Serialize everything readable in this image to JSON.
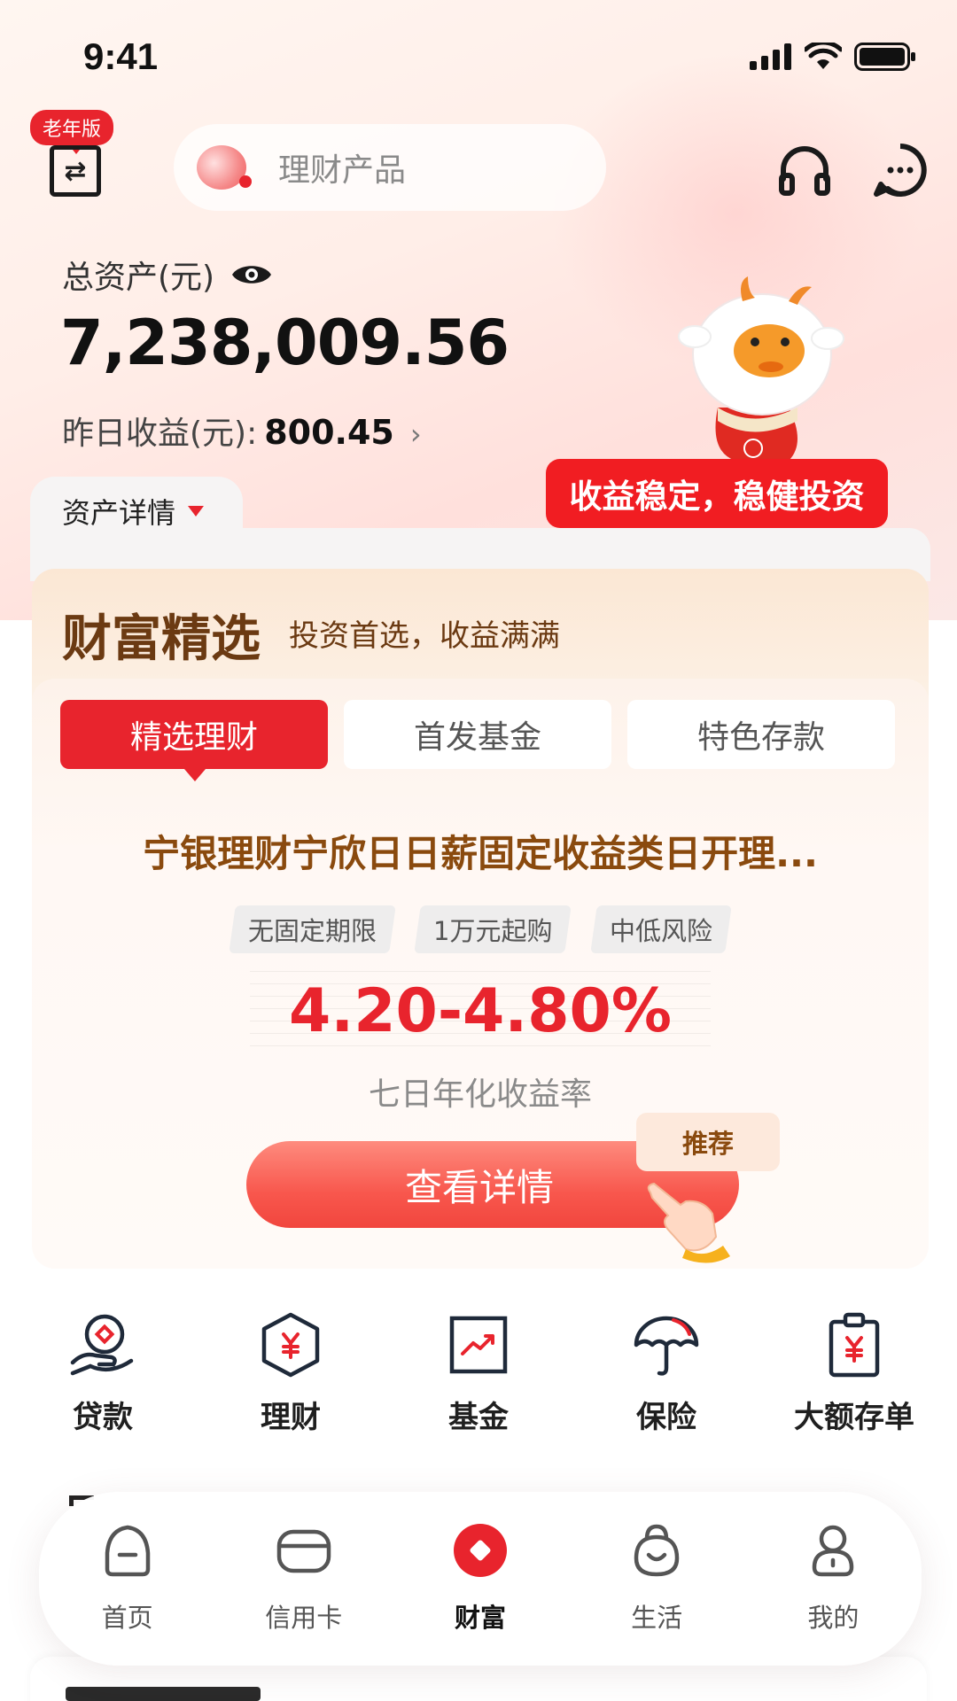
{
  "status_bar": {
    "time": "9:41"
  },
  "top_bar": {
    "elder_badge": "老年版",
    "search_placeholder": "理财产品"
  },
  "assets": {
    "total_label": "总资产(元)",
    "total_amount": "7,238,009.56",
    "yesterday_label": "昨日收益(元):",
    "yesterday_value": "800.45",
    "detail_tab": "资产详情"
  },
  "promo_bubble": "收益稳定，稳健投资",
  "wealth": {
    "title": "财富精选",
    "subtitle": "投资首选，收益满满",
    "tabs": [
      {
        "label": "精选理财",
        "active": true
      },
      {
        "label": "首发基金",
        "active": false
      },
      {
        "label": "特色存款",
        "active": false
      }
    ],
    "product_name": "宁银理财宁欣日日薪固定收益类日开理...",
    "tags": [
      "无固定期限",
      "1万元起购",
      "中低风险"
    ],
    "rate": "4.20-4.80%",
    "rate_label": "七日年化收益率",
    "button_label": "查看详情",
    "recommend_label": "推荐"
  },
  "quick_menu": [
    {
      "label": "贷款",
      "icon": "loan-icon"
    },
    {
      "label": "理财",
      "icon": "wealth-icon"
    },
    {
      "label": "基金",
      "icon": "fund-icon"
    },
    {
      "label": "保险",
      "icon": "insurance-icon"
    },
    {
      "label": "大额存单",
      "icon": "deposit-icon"
    }
  ],
  "bottom_nav": [
    {
      "label": "首页",
      "icon": "home-icon",
      "active": false
    },
    {
      "label": "信用卡",
      "icon": "card-icon",
      "active": false
    },
    {
      "label": "财富",
      "icon": "wealth-nav-icon",
      "active": true
    },
    {
      "label": "生活",
      "icon": "life-icon",
      "active": false
    },
    {
      "label": "我的",
      "icon": "profile-icon",
      "active": false
    }
  ],
  "colors": {
    "accent": "#e8242d",
    "gold_text": "#8a4a0e",
    "wealth_title": "#6b3a12"
  }
}
